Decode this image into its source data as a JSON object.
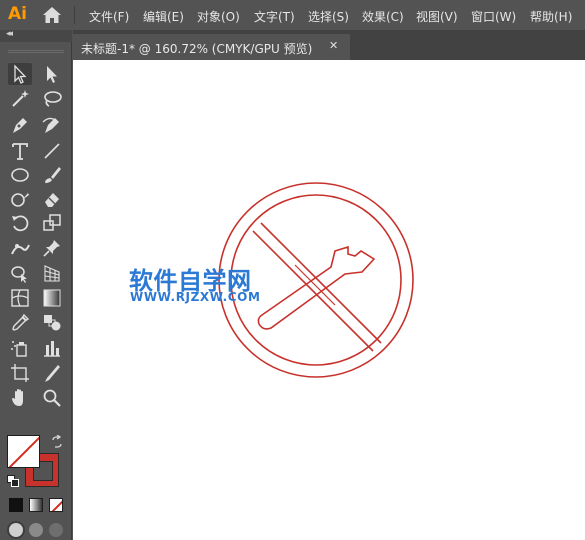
{
  "app": {
    "logo": "Ai"
  },
  "menu": {
    "items": [
      "文件(F)",
      "编辑(E)",
      "对象(O)",
      "文字(T)",
      "选择(S)",
      "效果(C)",
      "视图(V)",
      "窗口(W)",
      "帮助(H)"
    ]
  },
  "tools_panel": {
    "collapse_label": "◂◂"
  },
  "document": {
    "tab_title": "未标题-1* @ 160.72% (CMYK/GPU 预览)",
    "close_glyph": "✕",
    "zoom": "160.72%",
    "color_mode": "CMYK/GPU 预览"
  },
  "watermark": {
    "main": "软件自学网",
    "sub": "WWW.RJZXW.COM"
  },
  "colors": {
    "accent_logo": "#ff9a00",
    "artwork_stroke": "#c8322c",
    "watermark": "#2b79d4",
    "stroke_swatch": "#c8322c",
    "fill_swatch": "#ffffff"
  },
  "icons": {
    "home": "home-icon",
    "selection": "selection-tool-icon",
    "direct_selection": "direct-selection-tool-icon",
    "magic_wand": "magic-wand-tool-icon",
    "lasso": "lasso-tool-icon",
    "pen": "pen-tool-icon",
    "curvature": "curvature-tool-icon",
    "type": "type-tool-icon",
    "line": "line-segment-tool-icon",
    "ellipse": "ellipse-tool-icon",
    "paintbrush": "paintbrush-tool-icon",
    "shaper": "shaper-tool-icon",
    "eraser": "eraser-tool-icon",
    "rotate": "rotate-tool-icon",
    "scale": "scale-tool-icon",
    "puppet_warp": "puppet-warp-tool-icon",
    "pin": "pin-icon",
    "shape_builder": "shape-builder-tool-icon",
    "perspective_grid": "perspective-grid-tool-icon",
    "mesh": "mesh-tool-icon",
    "gradient": "gradient-tool-icon",
    "eyedropper": "eyedropper-tool-icon",
    "blend": "blend-tool-icon",
    "symbol_sprayer": "symbol-sprayer-tool-icon",
    "column_graph": "column-graph-tool-icon",
    "artboard": "artboard-tool-icon",
    "slice": "slice-tool-icon",
    "hand": "hand-tool-icon",
    "zoom": "zoom-tool-icon"
  }
}
